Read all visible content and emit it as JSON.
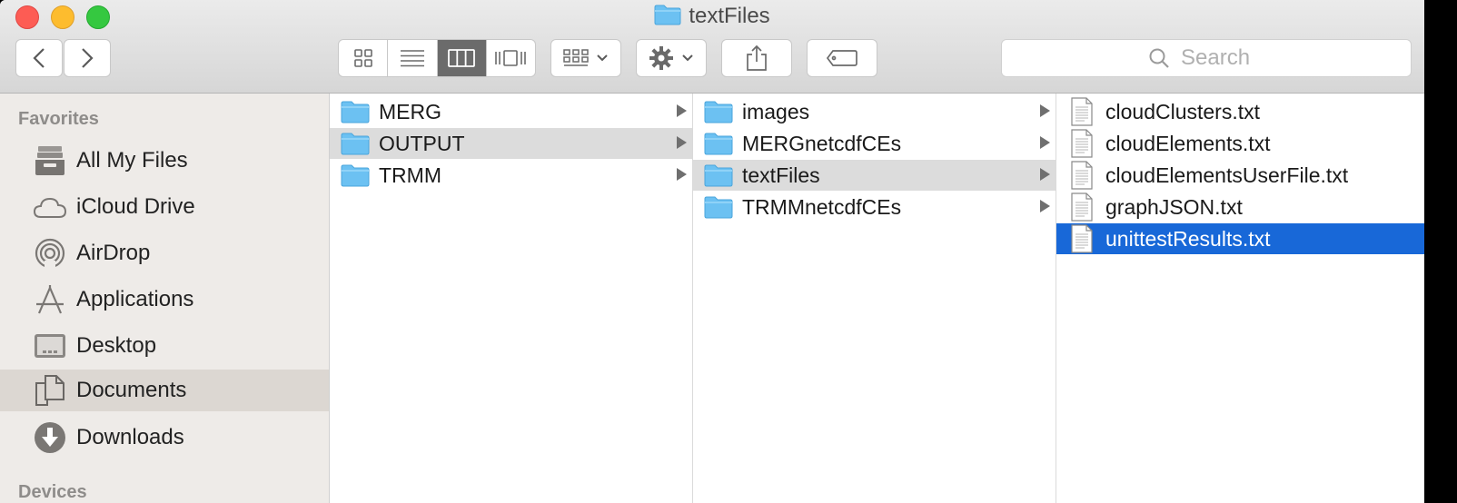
{
  "window": {
    "title": "textFiles"
  },
  "toolbar": {
    "view_modes": [
      "icon",
      "list",
      "column",
      "cover-flow"
    ],
    "active_view": "column",
    "search_placeholder": "Search"
  },
  "sidebar": {
    "heading": "Favorites",
    "items": [
      {
        "label": "All My Files",
        "icon": "all-files-icon"
      },
      {
        "label": "iCloud Drive",
        "icon": "cloud-icon"
      },
      {
        "label": "AirDrop",
        "icon": "airdrop-icon"
      },
      {
        "label": "Applications",
        "icon": "applications-icon"
      },
      {
        "label": "Desktop",
        "icon": "desktop-icon"
      },
      {
        "label": "Documents",
        "icon": "documents-icon",
        "selected": true
      },
      {
        "label": "Downloads",
        "icon": "downloads-icon"
      }
    ],
    "devices_heading": "Devices"
  },
  "columns": [
    {
      "items": [
        {
          "name": "MERG"
        },
        {
          "name": "OUTPUT",
          "highlighted": true
        },
        {
          "name": "TRMM"
        }
      ]
    },
    {
      "items": [
        {
          "name": "images"
        },
        {
          "name": "MERGnetcdfCEs"
        },
        {
          "name": "textFiles",
          "highlighted": true
        },
        {
          "name": "TRMMnetcdfCEs"
        }
      ]
    },
    {
      "items": [
        {
          "name": "cloudClusters.txt"
        },
        {
          "name": "cloudElements.txt"
        },
        {
          "name": "cloudElementsUserFile.txt"
        },
        {
          "name": "graphJSON.txt"
        },
        {
          "name": "unittestResults.txt",
          "selected": true
        }
      ]
    }
  ],
  "colors": {
    "selection": "#1868d8",
    "folder": "#6cc1f2"
  }
}
